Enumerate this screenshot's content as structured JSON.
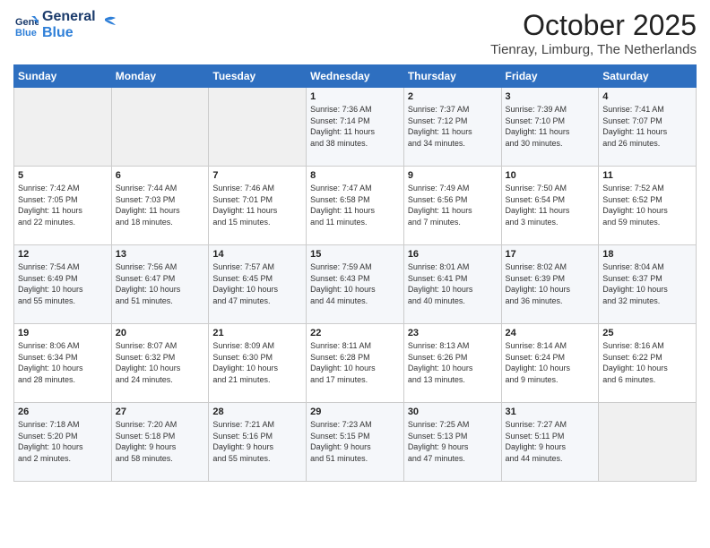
{
  "header": {
    "logo_line1": "General",
    "logo_line2": "Blue",
    "title": "October 2025",
    "subtitle": "Tienray, Limburg, The Netherlands"
  },
  "weekdays": [
    "Sunday",
    "Monday",
    "Tuesday",
    "Wednesday",
    "Thursday",
    "Friday",
    "Saturday"
  ],
  "weeks": [
    [
      {
        "day": "",
        "info": ""
      },
      {
        "day": "",
        "info": ""
      },
      {
        "day": "",
        "info": ""
      },
      {
        "day": "1",
        "info": "Sunrise: 7:36 AM\nSunset: 7:14 PM\nDaylight: 11 hours\nand 38 minutes."
      },
      {
        "day": "2",
        "info": "Sunrise: 7:37 AM\nSunset: 7:12 PM\nDaylight: 11 hours\nand 34 minutes."
      },
      {
        "day": "3",
        "info": "Sunrise: 7:39 AM\nSunset: 7:10 PM\nDaylight: 11 hours\nand 30 minutes."
      },
      {
        "day": "4",
        "info": "Sunrise: 7:41 AM\nSunset: 7:07 PM\nDaylight: 11 hours\nand 26 minutes."
      }
    ],
    [
      {
        "day": "5",
        "info": "Sunrise: 7:42 AM\nSunset: 7:05 PM\nDaylight: 11 hours\nand 22 minutes."
      },
      {
        "day": "6",
        "info": "Sunrise: 7:44 AM\nSunset: 7:03 PM\nDaylight: 11 hours\nand 18 minutes."
      },
      {
        "day": "7",
        "info": "Sunrise: 7:46 AM\nSunset: 7:01 PM\nDaylight: 11 hours\nand 15 minutes."
      },
      {
        "day": "8",
        "info": "Sunrise: 7:47 AM\nSunset: 6:58 PM\nDaylight: 11 hours\nand 11 minutes."
      },
      {
        "day": "9",
        "info": "Sunrise: 7:49 AM\nSunset: 6:56 PM\nDaylight: 11 hours\nand 7 minutes."
      },
      {
        "day": "10",
        "info": "Sunrise: 7:50 AM\nSunset: 6:54 PM\nDaylight: 11 hours\nand 3 minutes."
      },
      {
        "day": "11",
        "info": "Sunrise: 7:52 AM\nSunset: 6:52 PM\nDaylight: 10 hours\nand 59 minutes."
      }
    ],
    [
      {
        "day": "12",
        "info": "Sunrise: 7:54 AM\nSunset: 6:49 PM\nDaylight: 10 hours\nand 55 minutes."
      },
      {
        "day": "13",
        "info": "Sunrise: 7:56 AM\nSunset: 6:47 PM\nDaylight: 10 hours\nand 51 minutes."
      },
      {
        "day": "14",
        "info": "Sunrise: 7:57 AM\nSunset: 6:45 PM\nDaylight: 10 hours\nand 47 minutes."
      },
      {
        "day": "15",
        "info": "Sunrise: 7:59 AM\nSunset: 6:43 PM\nDaylight: 10 hours\nand 44 minutes."
      },
      {
        "day": "16",
        "info": "Sunrise: 8:01 AM\nSunset: 6:41 PM\nDaylight: 10 hours\nand 40 minutes."
      },
      {
        "day": "17",
        "info": "Sunrise: 8:02 AM\nSunset: 6:39 PM\nDaylight: 10 hours\nand 36 minutes."
      },
      {
        "day": "18",
        "info": "Sunrise: 8:04 AM\nSunset: 6:37 PM\nDaylight: 10 hours\nand 32 minutes."
      }
    ],
    [
      {
        "day": "19",
        "info": "Sunrise: 8:06 AM\nSunset: 6:34 PM\nDaylight: 10 hours\nand 28 minutes."
      },
      {
        "day": "20",
        "info": "Sunrise: 8:07 AM\nSunset: 6:32 PM\nDaylight: 10 hours\nand 24 minutes."
      },
      {
        "day": "21",
        "info": "Sunrise: 8:09 AM\nSunset: 6:30 PM\nDaylight: 10 hours\nand 21 minutes."
      },
      {
        "day": "22",
        "info": "Sunrise: 8:11 AM\nSunset: 6:28 PM\nDaylight: 10 hours\nand 17 minutes."
      },
      {
        "day": "23",
        "info": "Sunrise: 8:13 AM\nSunset: 6:26 PM\nDaylight: 10 hours\nand 13 minutes."
      },
      {
        "day": "24",
        "info": "Sunrise: 8:14 AM\nSunset: 6:24 PM\nDaylight: 10 hours\nand 9 minutes."
      },
      {
        "day": "25",
        "info": "Sunrise: 8:16 AM\nSunset: 6:22 PM\nDaylight: 10 hours\nand 6 minutes."
      }
    ],
    [
      {
        "day": "26",
        "info": "Sunrise: 7:18 AM\nSunset: 5:20 PM\nDaylight: 10 hours\nand 2 minutes."
      },
      {
        "day": "27",
        "info": "Sunrise: 7:20 AM\nSunset: 5:18 PM\nDaylight: 9 hours\nand 58 minutes."
      },
      {
        "day": "28",
        "info": "Sunrise: 7:21 AM\nSunset: 5:16 PM\nDaylight: 9 hours\nand 55 minutes."
      },
      {
        "day": "29",
        "info": "Sunrise: 7:23 AM\nSunset: 5:15 PM\nDaylight: 9 hours\nand 51 minutes."
      },
      {
        "day": "30",
        "info": "Sunrise: 7:25 AM\nSunset: 5:13 PM\nDaylight: 9 hours\nand 47 minutes."
      },
      {
        "day": "31",
        "info": "Sunrise: 7:27 AM\nSunset: 5:11 PM\nDaylight: 9 hours\nand 44 minutes."
      },
      {
        "day": "",
        "info": ""
      }
    ]
  ]
}
